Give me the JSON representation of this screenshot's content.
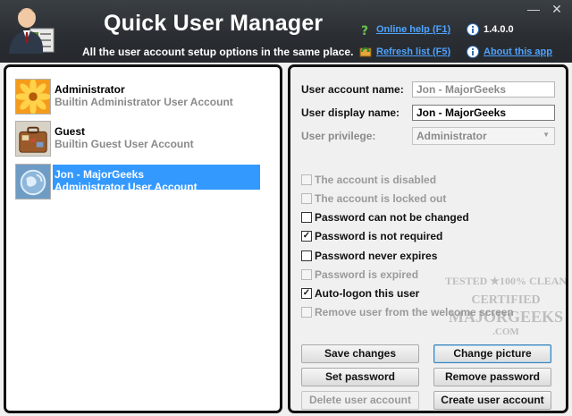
{
  "header": {
    "title": "Quick User Manager",
    "subtitle": "All the user account setup options in the same place.",
    "online_help": "Online help (F1)",
    "refresh_list": "Refresh list (F5)",
    "version": "1.4.0.0",
    "about": "About this app"
  },
  "window": {
    "minimize": "—",
    "close": "✕"
  },
  "users": [
    {
      "name": "Administrator",
      "desc": "Builtin Administrator User Account",
      "avatar": "flower-avatar-icon"
    },
    {
      "name": "Guest",
      "desc": "Builtin Guest User Account",
      "avatar": "suitcase-avatar-icon"
    },
    {
      "name": "Jon - MajorGeeks",
      "desc": "Administrator User Account",
      "avatar": "globe-avatar-icon",
      "selected": true
    }
  ],
  "form": {
    "account_name_label": "User account name:",
    "account_name_value": "Jon - MajorGeeks",
    "display_name_label": "User display name:",
    "display_name_value": "Jon - MajorGeeks",
    "privilege_label": "User privilege:",
    "privilege_value": "Administrator"
  },
  "options": [
    {
      "label": "The account is disabled",
      "checked": false,
      "enabled": false
    },
    {
      "label": "The account is locked out",
      "checked": false,
      "enabled": false
    },
    {
      "label": "Password can not be changed",
      "checked": false,
      "enabled": true
    },
    {
      "label": "Password is not required",
      "checked": true,
      "enabled": true
    },
    {
      "label": "Password never expires",
      "checked": false,
      "enabled": true
    },
    {
      "label": "Password is expired",
      "checked": false,
      "enabled": false
    },
    {
      "label": "Auto-logon this user",
      "checked": true,
      "enabled": true
    },
    {
      "label": "Remove user from the welcome screen",
      "checked": false,
      "enabled": false
    }
  ],
  "buttons": {
    "save_changes": "Save changes",
    "change_picture": "Change picture",
    "set_password": "Set password",
    "remove_password": "Remove password",
    "delete_user": "Delete user account",
    "create_user": "Create user account"
  },
  "watermark": {
    "line1": "TESTED ★100% CLEAN",
    "line2": "CERTIFIED",
    "line3": "MAJORGEEKS",
    ".com": ".COM"
  },
  "colors": {
    "header_bg": "#2a2e33",
    "link": "#4fa3ff",
    "selection": "#3399ff"
  }
}
